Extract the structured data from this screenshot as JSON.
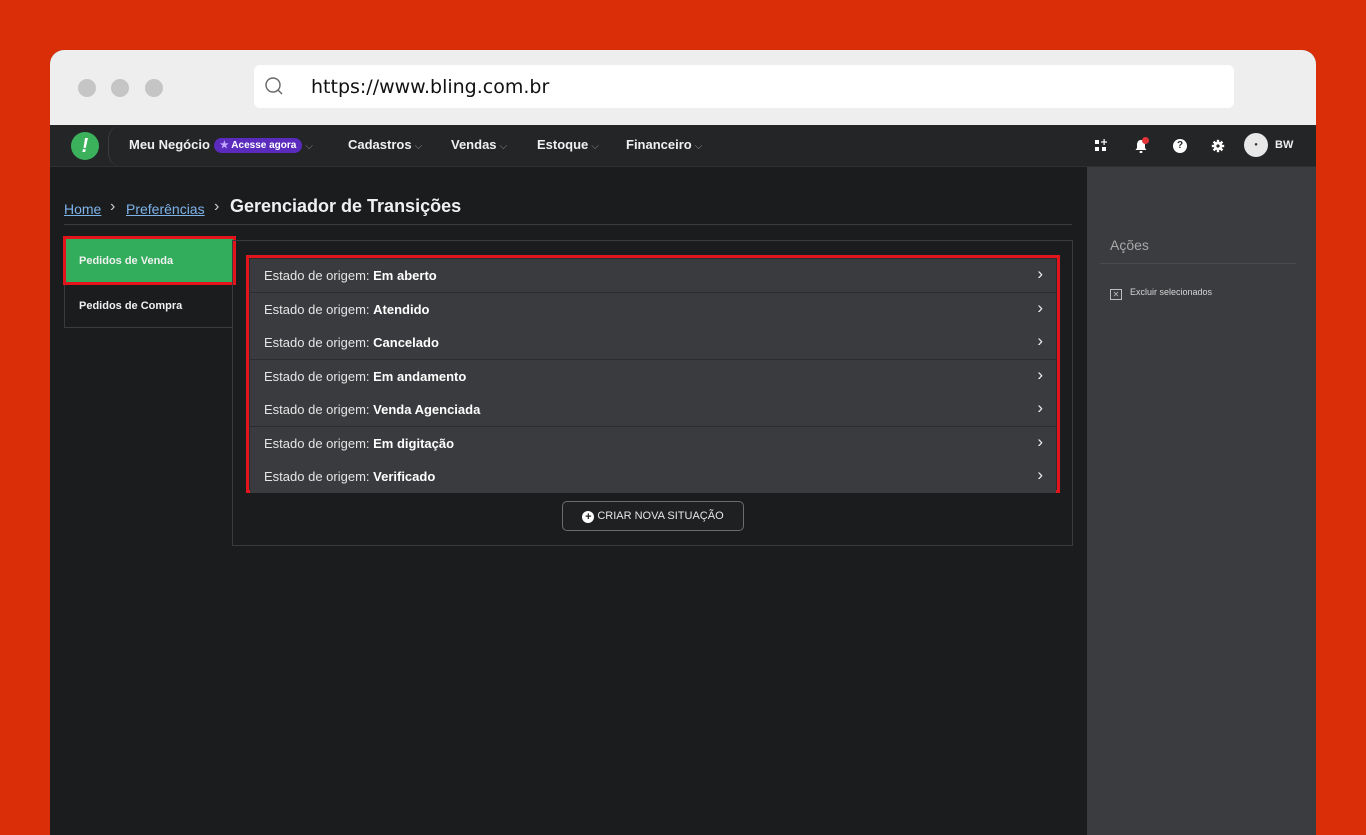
{
  "browser": {
    "url": "https://www.bling.com.br"
  },
  "topnav": {
    "logo": "!",
    "items": [
      {
        "label": "Meu Negócio",
        "badge": "Acesse agora"
      },
      {
        "label": "Cadastros"
      },
      {
        "label": "Vendas"
      },
      {
        "label": "Estoque"
      },
      {
        "label": "Financeiro"
      }
    ],
    "icons": [
      "apps-icon",
      "bell-icon",
      "help-icon",
      "gear-icon",
      "avatar"
    ],
    "avatar_initials": "BW"
  },
  "breadcrumb": {
    "home": "Home",
    "preferences": "Preferências",
    "title": "Gerenciador de Transições"
  },
  "sidemenu": {
    "items": [
      {
        "label": "Pedidos de Venda",
        "active": true
      },
      {
        "label": "Pedidos de Compra",
        "active": false
      }
    ]
  },
  "states": {
    "prefix": "Estado de origem:",
    "items": [
      "Em aberto",
      "Atendido",
      "Cancelado",
      "Em andamento",
      "Venda Agenciada",
      "Em digitação",
      "Verificado"
    ]
  },
  "create_button": "CRIAR NOVA SITUAÇÃO",
  "actions": {
    "title": "Ações",
    "items": [
      "Excluir selecionados"
    ]
  },
  "colors": {
    "background": "#d92e07",
    "active_green": "#32ad5b",
    "highlight_red": "#e2141c",
    "badge_purple": "#5a2bbd"
  }
}
